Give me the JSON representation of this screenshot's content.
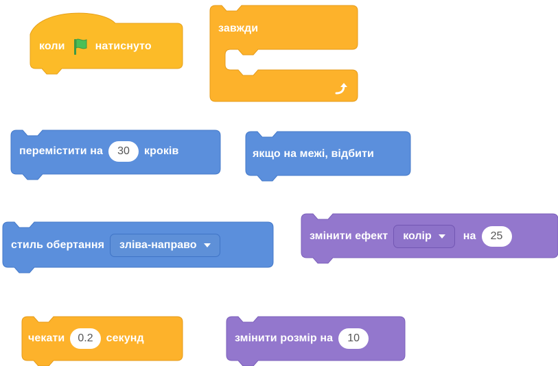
{
  "colors": {
    "events": "#fcbb28",
    "events_border": "#e6a11b",
    "control": "#fdb22b",
    "control_border": "#e59b19",
    "motion": "#5b8fdc",
    "motion_border": "#4479c9",
    "looks": "#9377cd",
    "looks_border": "#7b5fba",
    "flag": "#4cbf56"
  },
  "blocks": {
    "when_flag": {
      "label_before": "коли",
      "icon": "green-flag-icon",
      "label_after": "натиснуто"
    },
    "forever": {
      "label": "завжди",
      "icon": "loop-arrow-icon"
    },
    "move": {
      "label_before": "перемістити на",
      "value": "30",
      "label_after": "кроків"
    },
    "bounce": {
      "label": "якщо на межі, відбити"
    },
    "rotation_style": {
      "label": "стиль обертання",
      "dropdown_value": "зліва-направо"
    },
    "change_effect": {
      "label_before": "змінити ефект",
      "dropdown_value": "колір",
      "label_middle": "на",
      "value": "25"
    },
    "wait": {
      "label_before": "чекати",
      "value": "0.2",
      "label_after": "секунд"
    },
    "change_size": {
      "label": "змінити розмір на",
      "value": "10"
    }
  }
}
